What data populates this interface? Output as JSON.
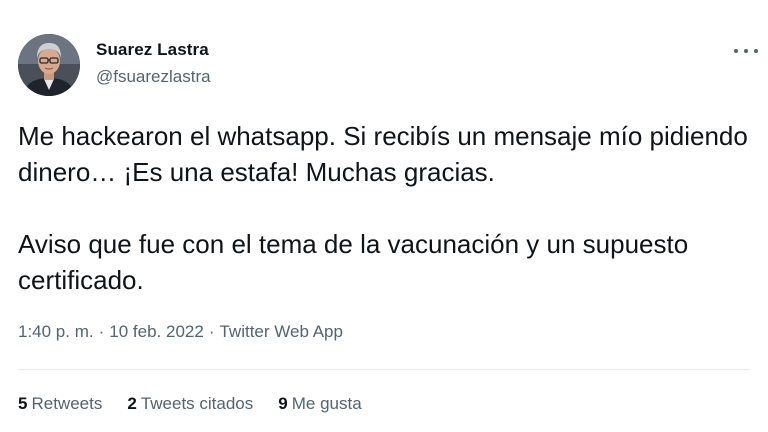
{
  "author": {
    "name": "Suarez Lastra",
    "handle": "@fsuarezlastra"
  },
  "tweet": {
    "paragraph_1": "Me hackearon el whatsapp. Si recibís un mensaje mío pidiendo dinero… ¡Es una estafa! Muchas gracias.",
    "paragraph_2": "Aviso que fue con el tema de la vacunación y un supuesto certificado."
  },
  "meta": {
    "time": "1:40 p. m.",
    "separator": "·",
    "date": "10 feb. 2022",
    "source": "Twitter Web App"
  },
  "stats": {
    "retweets_count": "5",
    "retweets_label": "Retweets",
    "quotes_count": "2",
    "quotes_label": "Tweets citados",
    "likes_count": "9",
    "likes_label": "Me gusta"
  },
  "colors": {
    "text": "#0f1419",
    "secondary": "#536471",
    "divider": "#e6ecf0"
  },
  "icons": {
    "more": "more-options-icon"
  }
}
